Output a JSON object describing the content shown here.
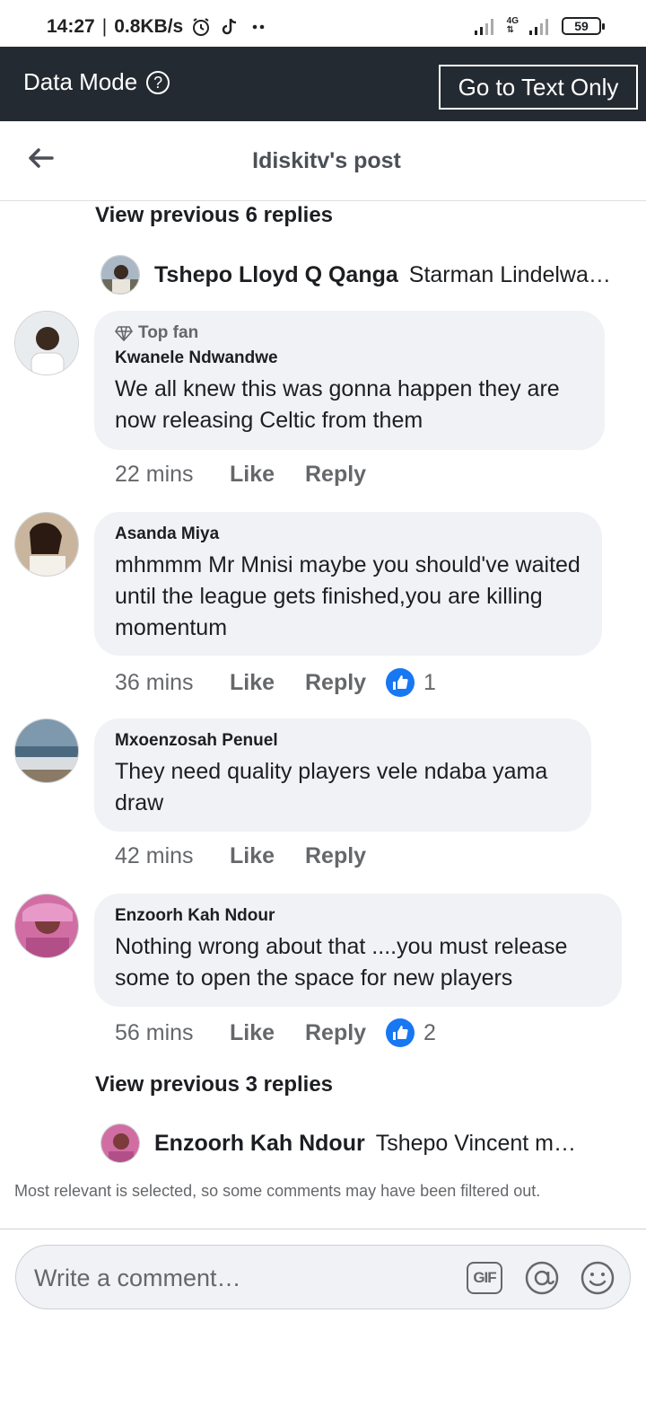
{
  "status_bar": {
    "time": "14:27",
    "speed": "0.8KB/s",
    "network": "4G",
    "battery": "59"
  },
  "data_mode": {
    "label": "Data Mode",
    "help_icon": "question-circle-icon",
    "button": "Go to Text Only"
  },
  "header": {
    "title": "Idiskitv's post",
    "back_icon": "back-arrow-icon"
  },
  "thread_top": {
    "view_previous": "View previous 6 replies",
    "reply": {
      "name": "Tshepo Lloyd Q Qanga",
      "snippet": "Starman Lindelwa Msomi"
    }
  },
  "comments": [
    {
      "badge": "Top fan",
      "name": "Kwanele Ndwandwe",
      "text": "We all knew this was gonna happen they are now releasing Celtic from them",
      "time": "22 mins",
      "like": "Like",
      "reply": "Reply",
      "reactions": ""
    },
    {
      "badge": "",
      "name": "Asanda Miya",
      "text": "mhmmm Mr Mnisi maybe you should've waited until the league gets finished,you are killing momentum",
      "time": "36 mins",
      "like": "Like",
      "reply": "Reply",
      "reactions": "1"
    },
    {
      "badge": "",
      "name": "Mxoenzosah Penuel",
      "text": "They need quality players vele ndaba yama draw",
      "time": "42 mins",
      "like": "Like",
      "reply": "Reply",
      "reactions": ""
    },
    {
      "badge": "",
      "name": "Enzoorh Kah Ndour",
      "text": "Nothing wrong about that ....you must release some to open the space for new players",
      "time": "56 mins",
      "like": "Like",
      "reply": "Reply",
      "reactions": "2"
    }
  ],
  "thread_bottom": {
    "view_previous": "View previous 3 replies",
    "reply": {
      "name": "Enzoorh Kah Ndour",
      "snippet": "Tshepo Vincent maybe"
    }
  },
  "filter_note": "Most relevant is selected, so some comments may have been filtered out.",
  "composer": {
    "placeholder": "Write a comment…",
    "gif_label": "GIF",
    "at_icon": "mention-icon",
    "emoji_icon": "emoji-icon"
  },
  "colors": {
    "data_bar": "#242a31",
    "bubble": "#f0f2f5",
    "like_blue": "#1877f2",
    "meta_gray": "#65676b"
  }
}
